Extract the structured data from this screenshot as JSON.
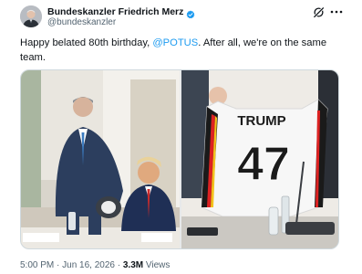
{
  "author": {
    "display_name": "Bundeskanzler Friedrich Merz",
    "handle": "@bundeskanzler",
    "verified": true,
    "avatar_icon": "profile-photo"
  },
  "actions": {
    "grok_icon": "grok-icon",
    "more_icon": "more-icon"
  },
  "tweet": {
    "text_before": "Happy belated 80th birthday, ",
    "mention": "@POTUS",
    "text_after": ". After all, we're on the same team."
  },
  "media": {
    "count": 2,
    "jersey_name": "TRUMP",
    "jersey_number": "47"
  },
  "meta": {
    "time": "5:00 PM",
    "separator": " · ",
    "date": "Jun 16, 2026",
    "views_count": "3.3M",
    "views_label": " Views"
  },
  "colors": {
    "link": "#1d9bf0",
    "verified": "#1d9bf0",
    "secondary_text": "#536471"
  }
}
